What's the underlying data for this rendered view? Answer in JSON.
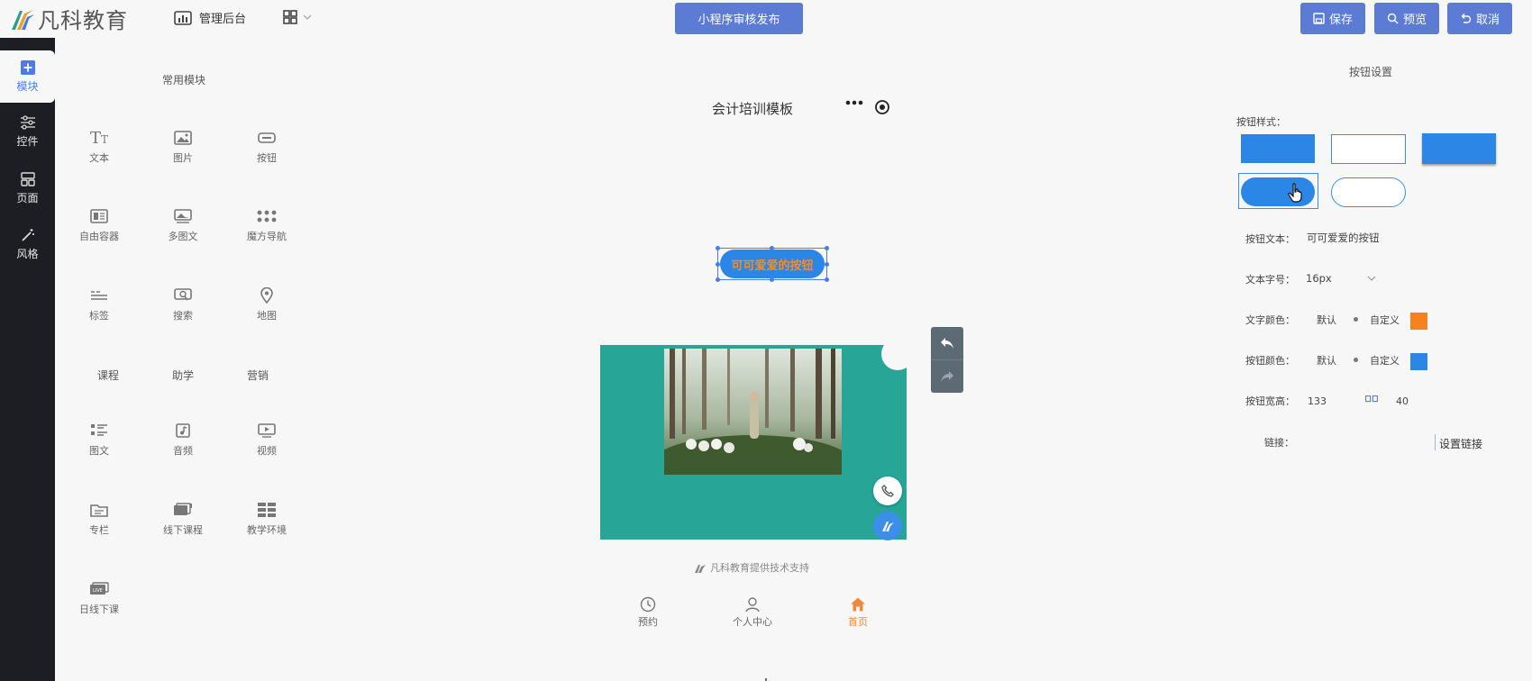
{
  "topbar": {
    "logo_text": "凡科教育",
    "admin_label": "管理后台",
    "publish_label": "小程序审核发布",
    "save_label": "保存",
    "preview_label": "预览",
    "cancel_label": "取消"
  },
  "sidebar": {
    "items": [
      {
        "label": "模块",
        "icon": "plus-square-icon"
      },
      {
        "label": "控件",
        "icon": "sliders-icon"
      },
      {
        "label": "页面",
        "icon": "layout-icon"
      },
      {
        "label": "风格",
        "icon": "magic-wand-icon"
      }
    ]
  },
  "modules": {
    "title": "常用模块",
    "common": [
      {
        "label": "文本",
        "icon": "text-icon"
      },
      {
        "label": "图片",
        "icon": "image-icon"
      },
      {
        "label": "按钮",
        "icon": "button-icon"
      },
      {
        "label": "自由容器",
        "icon": "container-icon"
      },
      {
        "label": "多图文",
        "icon": "multi-image-icon"
      },
      {
        "label": "魔方导航",
        "icon": "grid-nav-icon"
      },
      {
        "label": "标签",
        "icon": "tabs-icon"
      },
      {
        "label": "搜索",
        "icon": "search-icon"
      },
      {
        "label": "地图",
        "icon": "map-pin-icon"
      }
    ],
    "categories": [
      "课程",
      "助学",
      "营销"
    ],
    "course": [
      {
        "label": "图文",
        "icon": "article-icon"
      },
      {
        "label": "音频",
        "icon": "audio-icon"
      },
      {
        "label": "视频",
        "icon": "video-icon"
      },
      {
        "label": "专栏",
        "icon": "column-icon"
      },
      {
        "label": "线下课程",
        "icon": "offline-course-icon"
      },
      {
        "label": "教学环境",
        "icon": "environment-icon"
      },
      {
        "label": "日线下课",
        "icon": "live-icon"
      }
    ]
  },
  "preview": {
    "template_title": "会计培训模板",
    "button_text": "可可爱爱的按钮",
    "support_text": "凡科教育提供技术支持",
    "nav": [
      {
        "label": "预约",
        "icon": "clock-icon"
      },
      {
        "label": "个人中心",
        "icon": "user-icon"
      },
      {
        "label": "首页",
        "icon": "home-icon"
      }
    ]
  },
  "settings": {
    "title": "按钮设置",
    "style_label": "按钮样式：",
    "text_label": "按钮文本：",
    "text_value": "可可爱爱的按钮",
    "font_size_label": "文本字号：",
    "font_size_value": "16px",
    "text_color_label": "文字颜色：",
    "btn_color_label": "按钮颜色：",
    "default_label": "默认",
    "custom_label": "自定义",
    "size_label": "按钮宽高：",
    "width_value": "133",
    "height_value": "40",
    "link_label": "链接：",
    "link_button": "设置链接",
    "text_color": "#f5821f",
    "button_color": "#2b86e6"
  },
  "colors": {
    "accent": "#5b7bd5",
    "sidebar_bg": "#1c1e23",
    "banner": "#27a597"
  }
}
